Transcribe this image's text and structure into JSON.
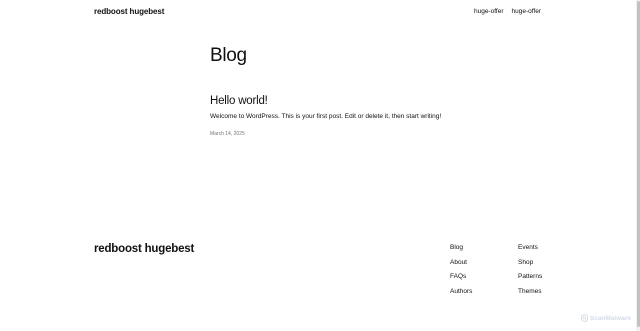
{
  "header": {
    "site_title": "redboost hugebest",
    "nav": [
      "huge-offer",
      "huge-offer"
    ]
  },
  "main": {
    "heading": "Blog",
    "post": {
      "title": "Hello world!",
      "excerpt": "Welcome to WordPress. This is your first post. Edit or delete it, then start writing!",
      "date": "March 14, 2025"
    }
  },
  "footer": {
    "site_title": "redboost hugebest",
    "col1": [
      "Blog",
      "About",
      "FAQs",
      "Authors"
    ],
    "col2": [
      "Events",
      "Shop",
      "Patterns",
      "Themes"
    ]
  },
  "watermark": {
    "text": "ScanMalware",
    "icon": "shield-scan-icon"
  }
}
